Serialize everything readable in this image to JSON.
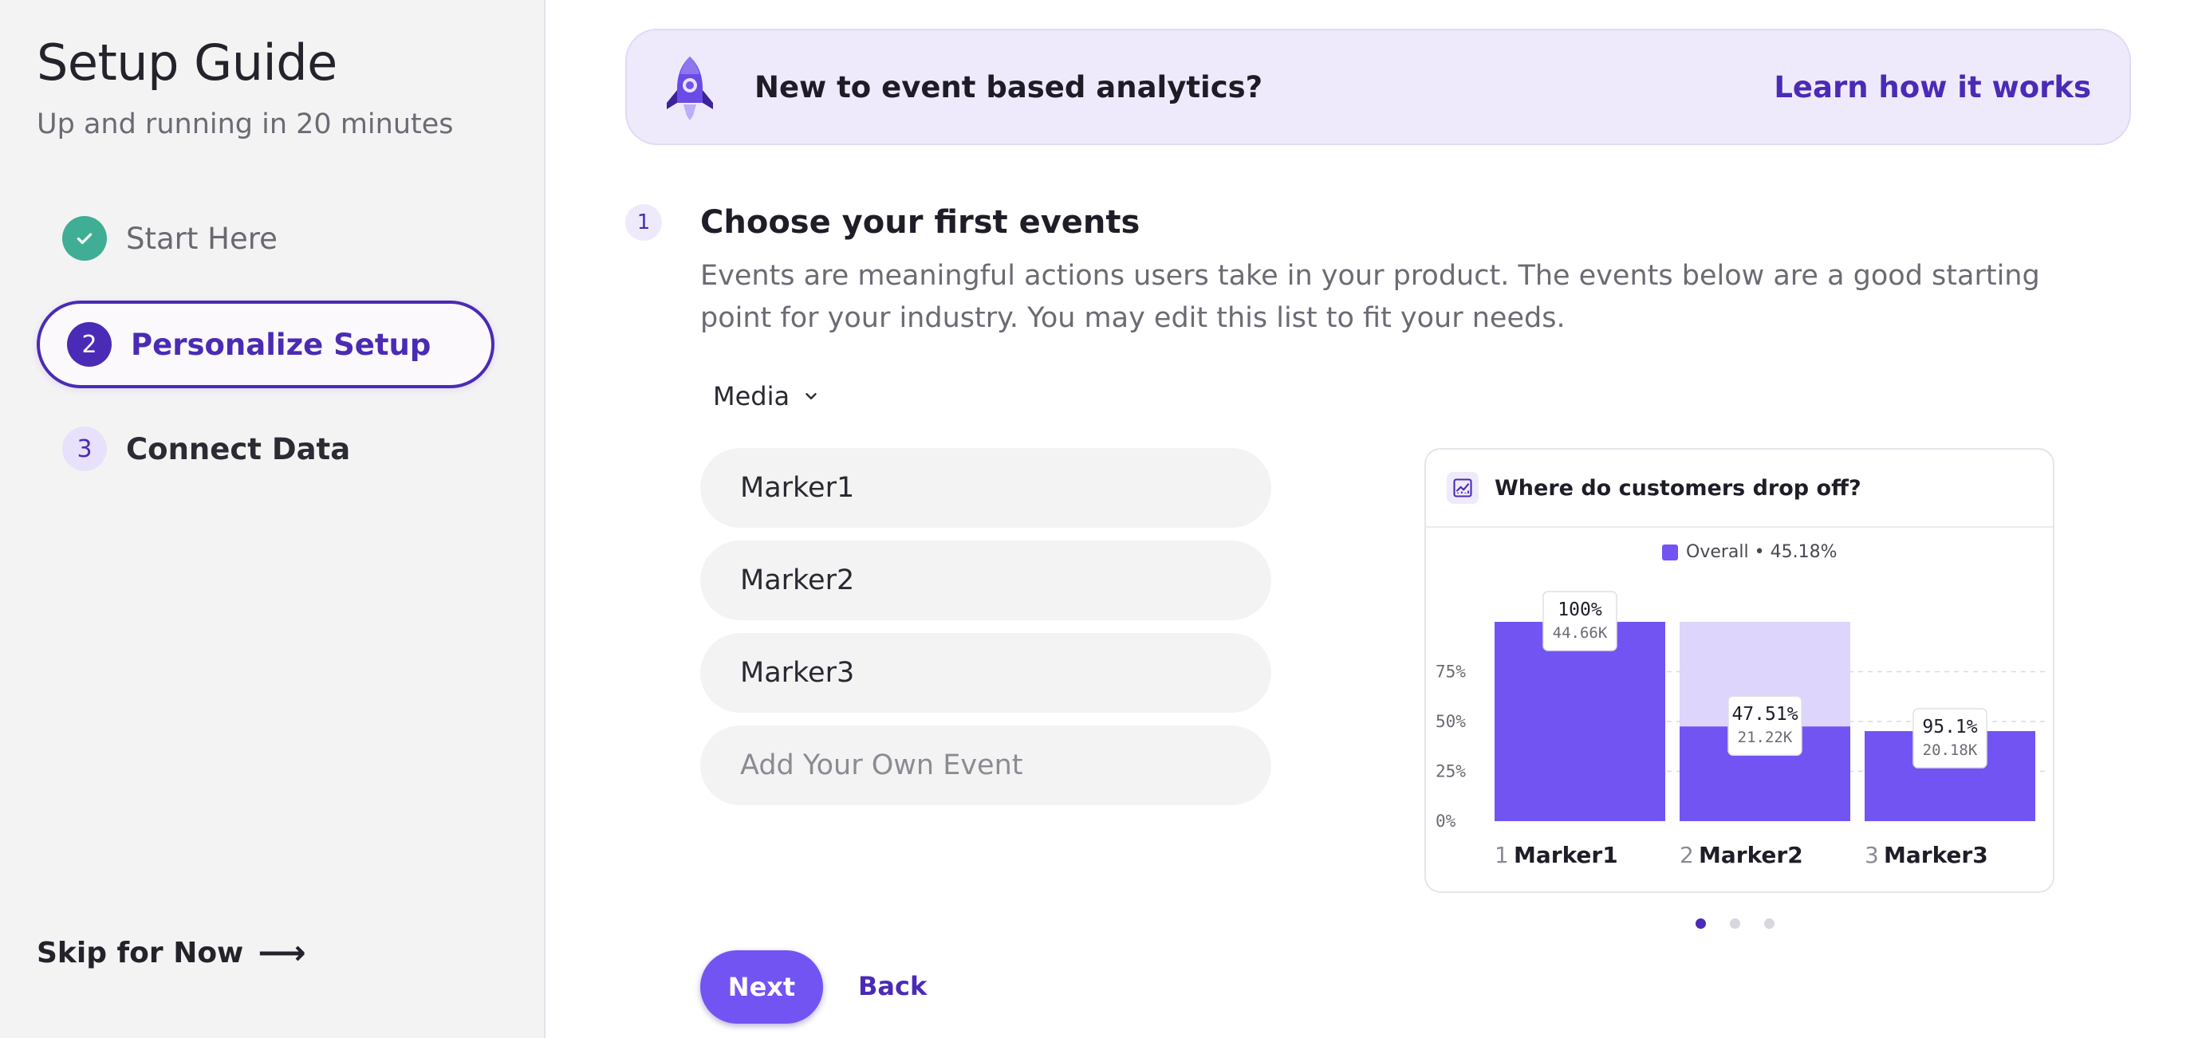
{
  "sidebar": {
    "title": "Setup Guide",
    "subtitle": "Up and running in 20 minutes",
    "steps": [
      {
        "badge": "",
        "label": "Start Here",
        "state": "done"
      },
      {
        "badge": "2",
        "label": "Personalize Setup",
        "state": "active"
      },
      {
        "badge": "3",
        "label": "Connect Data",
        "state": "upcoming"
      }
    ],
    "skip_label": "Skip for Now",
    "skip_arrow": "⟶"
  },
  "banner": {
    "text": "New to event based analytics?",
    "link": "Learn how it works",
    "icon": "rocket-icon"
  },
  "section": {
    "number": "1",
    "title": "Choose your first events",
    "description": "Events are meaningful actions users take in your product. The events below are a good starting point for your industry. You may edit this list to fit your needs."
  },
  "industry_select": {
    "value": "Media"
  },
  "events": [
    "Marker1",
    "Marker2",
    "Marker3"
  ],
  "add_event_placeholder": "Add Your Own Event",
  "chart_card": {
    "title": "Where do customers drop off?",
    "legend": "Overall • 45.18%",
    "pagination": {
      "count": 3,
      "active": 0
    }
  },
  "chart_data": {
    "type": "bar",
    "title": "Where do customers drop off?",
    "categories": [
      "Marker1",
      "Marker2",
      "Marker3"
    ],
    "step_numbers": [
      "1",
      "2",
      "3"
    ],
    "series": [
      {
        "name": "Overall • 45.18%",
        "values": [
          100,
          47.51,
          45.18
        ]
      }
    ],
    "dropoff_ghost": [
      false,
      true,
      false
    ],
    "labels": [
      {
        "pct": "100%",
        "count": "44.66K"
      },
      {
        "pct": "47.51%",
        "count": "21.22K"
      },
      {
        "pct": "95.1%",
        "count": "20.18K"
      }
    ],
    "yticks": [
      "0%",
      "25%",
      "50%",
      "75%"
    ],
    "ylim": [
      0,
      100
    ],
    "colors": {
      "bar": "#7254f3",
      "ghost": "#ddd5fb"
    }
  },
  "actions": {
    "next": "Next",
    "back": "Back"
  }
}
